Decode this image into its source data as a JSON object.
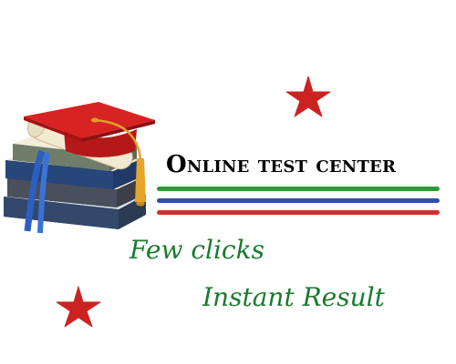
{
  "title": "Online test center",
  "taglines": {
    "first": "Few clicks",
    "second": "Instant Result"
  },
  "colors": {
    "tagline": "#1a7a2e",
    "star": "#cc2222",
    "stripe_green": "#2e9a3e",
    "stripe_blue": "#2f4fa8",
    "stripe_red": "#d12e2e"
  },
  "icons": {
    "graphic": "graduation-cap-books-diploma-icon",
    "decoration": "star-icon"
  }
}
